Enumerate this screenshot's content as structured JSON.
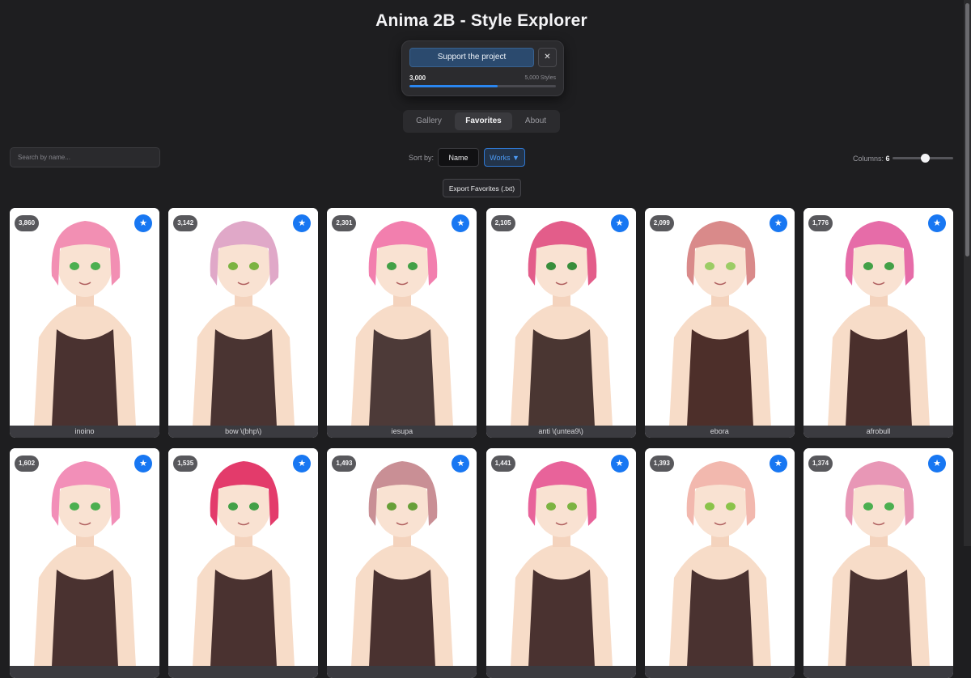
{
  "header": {
    "title": "Anima 2B - Style Explorer"
  },
  "support": {
    "button_label": "Support the project",
    "close_label": "✕",
    "current": "3,000",
    "goal_label": "5,000 Styles",
    "progress_fraction": 0.6
  },
  "tabs": [
    {
      "label": "Gallery",
      "active": false
    },
    {
      "label": "Favorites",
      "active": true
    },
    {
      "label": "About",
      "active": false
    }
  ],
  "toolbar": {
    "search_placeholder": "Search by name...",
    "sort_label": "Sort by:",
    "sort_name": "Name",
    "sort_works": "Works ▼",
    "columns_label": "Columns:",
    "columns_value": "6",
    "export_label": "Export Favorites (.txt)"
  },
  "colors": {
    "accent": "#1877f2",
    "background": "#1e1e20",
    "card_caption": "#3b3b40"
  },
  "cards": [
    {
      "count": "3,860",
      "name": "inoino",
      "hair": "#f28fb3",
      "dress": "#4a3230",
      "eyes": "#4caf50"
    },
    {
      "count": "3,142",
      "name": "bow \\(bhp\\)",
      "hair": "#e0a8c8",
      "dress": "#4a3432",
      "eyes": "#7cb342"
    },
    {
      "count": "2,301",
      "name": "iesupa",
      "hair": "#f27fae",
      "dress": "#4d3a38",
      "eyes": "#43a047"
    },
    {
      "count": "2,105",
      "name": "anti \\(untea9\\)",
      "hair": "#e35d8a",
      "dress": "#4a3632",
      "eyes": "#388e3c"
    },
    {
      "count": "2,099",
      "name": "ebora",
      "hair": "#d98a8a",
      "dress": "#4d2f2a",
      "eyes": "#9ccc65"
    },
    {
      "count": "1,776",
      "name": "afrobull",
      "hair": "#e66ca8",
      "dress": "#4a2f2c",
      "eyes": "#43a047"
    },
    {
      "count": "1,602",
      "name": "",
      "hair": "#f28fb8",
      "dress": "#4a3230",
      "eyes": "#4caf50"
    },
    {
      "count": "1,535",
      "name": "",
      "hair": "#e33b6b",
      "dress": "#4a3230",
      "eyes": "#43a047"
    },
    {
      "count": "1,493",
      "name": "",
      "hair": "#c98f95",
      "dress": "#4a3230",
      "eyes": "#689f38"
    },
    {
      "count": "1,441",
      "name": "",
      "hair": "#e8639a",
      "dress": "#4a3230",
      "eyes": "#7cb342"
    },
    {
      "count": "1,393",
      "name": "",
      "hair": "#f2b8ae",
      "dress": "#4a3230",
      "eyes": "#8bc34a"
    },
    {
      "count": "1,374",
      "name": "",
      "hair": "#e897b6",
      "dress": "#4a3230",
      "eyes": "#4caf50"
    }
  ]
}
